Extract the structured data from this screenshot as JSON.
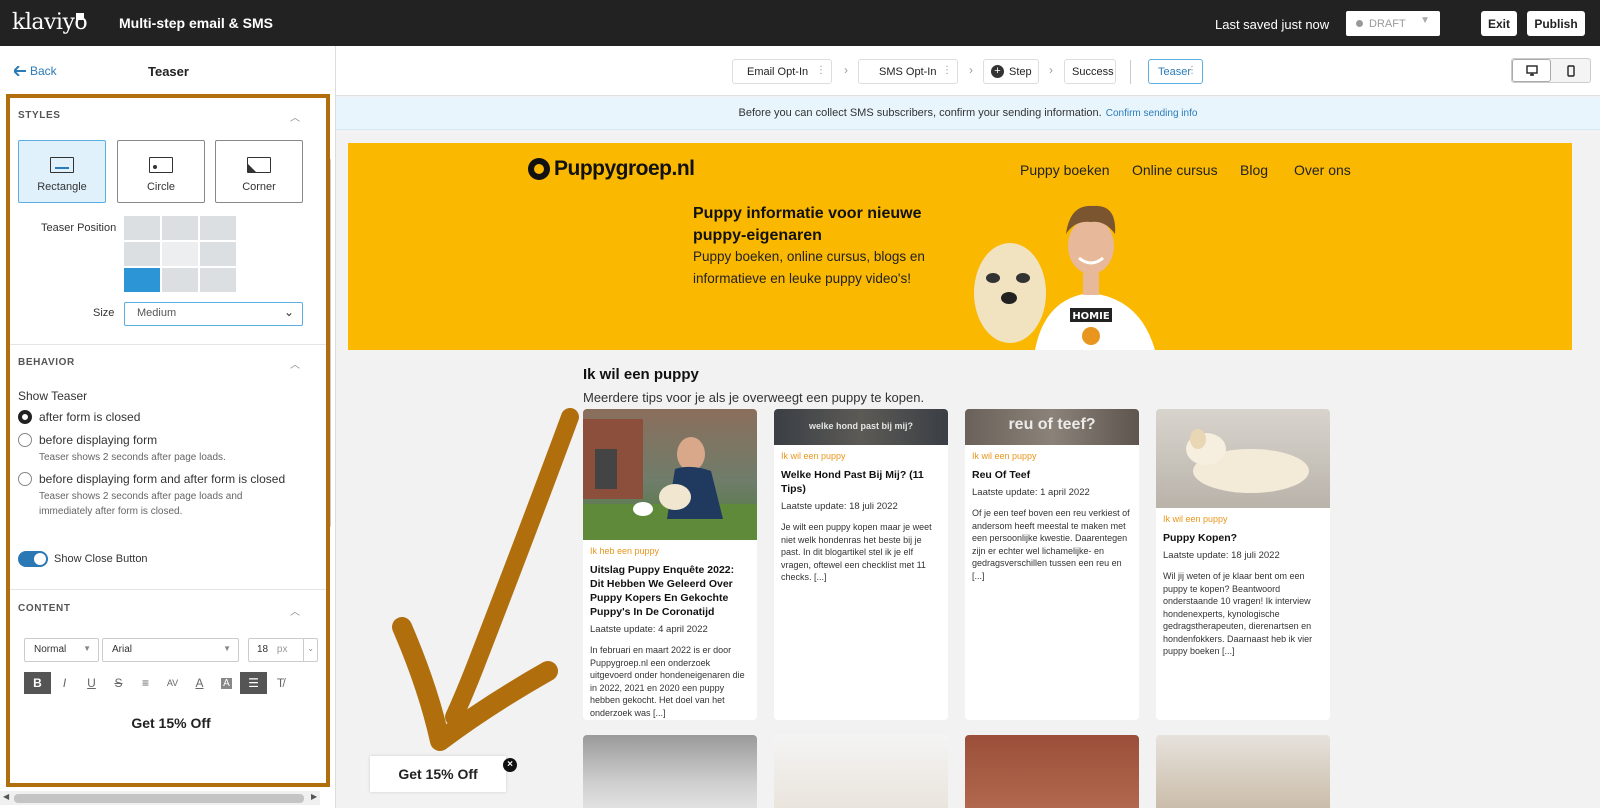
{
  "header": {
    "logo": "klaviyo",
    "title": "Multi-step email & SMS",
    "saved_status": "Last saved just now",
    "status": "DRAFT",
    "exit_label": "Exit",
    "publish_label": "Publish"
  },
  "panel": {
    "back_label": "Back",
    "title": "Teaser",
    "styles": {
      "heading": "STYLES",
      "options": [
        "Rectangle",
        "Circle",
        "Corner"
      ],
      "selected": "Rectangle",
      "position_label": "Teaser Position",
      "position_selected": "bottom-left",
      "size_label": "Size",
      "size_value": "Medium"
    },
    "behavior": {
      "heading": "BEHAVIOR",
      "show_teaser_label": "Show Teaser",
      "options": [
        {
          "label": "after form is closed",
          "sub": "",
          "selected": true
        },
        {
          "label": "before displaying form",
          "sub": "Teaser shows 2 seconds after page loads.",
          "selected": false
        },
        {
          "label": "before displaying form and after form is closed",
          "sub": "Teaser shows 2 seconds after page loads and immediately after form is closed.",
          "selected": false
        }
      ],
      "close_button_label": "Show Close Button",
      "close_button_on": true
    },
    "content": {
      "heading": "CONTENT",
      "text_style": "Normal",
      "font": "Arial",
      "font_size": "18",
      "font_unit": "px",
      "editor_text": "Get 15% Off"
    }
  },
  "steps": {
    "items": [
      {
        "label": "Email Opt-In"
      },
      {
        "label": "SMS Opt-In"
      },
      {
        "label": "Step"
      },
      {
        "label": "Success"
      },
      {
        "label": "Teaser"
      }
    ],
    "active": "Teaser"
  },
  "notice": {
    "text": "Before you can collect SMS subscribers, confirm your sending information.",
    "link": "Confirm sending info"
  },
  "site": {
    "logo": "Puppygroep.nl",
    "nav": [
      "Puppy boeken",
      "Online cursus",
      "Blog",
      "Over ons"
    ],
    "hero_heading": "Puppy informatie voor nieuwe puppy-eigenaren",
    "hero_text": "Puppy boeken, online cursus, blogs en informatieve en leuke puppy video's!",
    "hero_shirt": "HOMIE",
    "section_heading": "Ik wil een puppy",
    "section_sub": "Meerdere tips voor je als je overweegt een puppy te kopen.",
    "cards": [
      {
        "overlay": "",
        "category": "Ik heb een puppy",
        "title": "Uitslag Puppy Enquête 2022: Dit Hebben We Geleerd Over Puppy Kopers En Gekochte Puppy's In De Coronatijd",
        "date": "Laatste update: 4 april 2022",
        "excerpt": "In februari en maart 2022 is er door Puppygroep.nl een onderzoek uitgevoerd onder hondeneigenaren die in 2022, 2021 en 2020 een puppy hebben gekocht. Het doel van het onderzoek was [...]"
      },
      {
        "overlay": "welke hond past bij mij?",
        "category": "Ik wil een puppy",
        "title": "Welke Hond Past Bij Mij? (11 Tips)",
        "date": "Laatste update: 18 juli 2022",
        "excerpt": "Je wilt een puppy kopen maar je weet niet welk hondenras het beste bij je past. In dit blogartikel stel ik je elf vragen, oftewel een checklist met 11 checks. [...]"
      },
      {
        "overlay": "reu of teef?",
        "category": "Ik wil een puppy",
        "title": "Reu Of Teef",
        "date": "Laatste update: 1 april 2022",
        "excerpt": "Of je een teef boven een reu verkiest of andersom heeft meestal te maken met een persoonlijke kwestie. Daarentegen zijn er echter wel lichamelijke- en gedragsverschillen tussen een reu en [...]"
      },
      {
        "overlay": "",
        "category": "Ik wil een puppy",
        "title": "Puppy Kopen?",
        "date": "Laatste update: 18 juli 2022",
        "excerpt": "Wil jij weten of je klaar bent om een puppy te kopen? Beantwoord onderstaande 10 vragen! Ik interview hondenexperts, kynologische gedragstherapeuten, dierenartsen en hondenfokkers. Daarnaast heb ik vier puppy boeken [...]"
      }
    ],
    "teaser_text": "Get 15% Off"
  },
  "colors": {
    "accent": "#2b7bb9",
    "highlight": "#b06e0c",
    "site_yellow": "#fbb800",
    "category": "#e8961e"
  }
}
